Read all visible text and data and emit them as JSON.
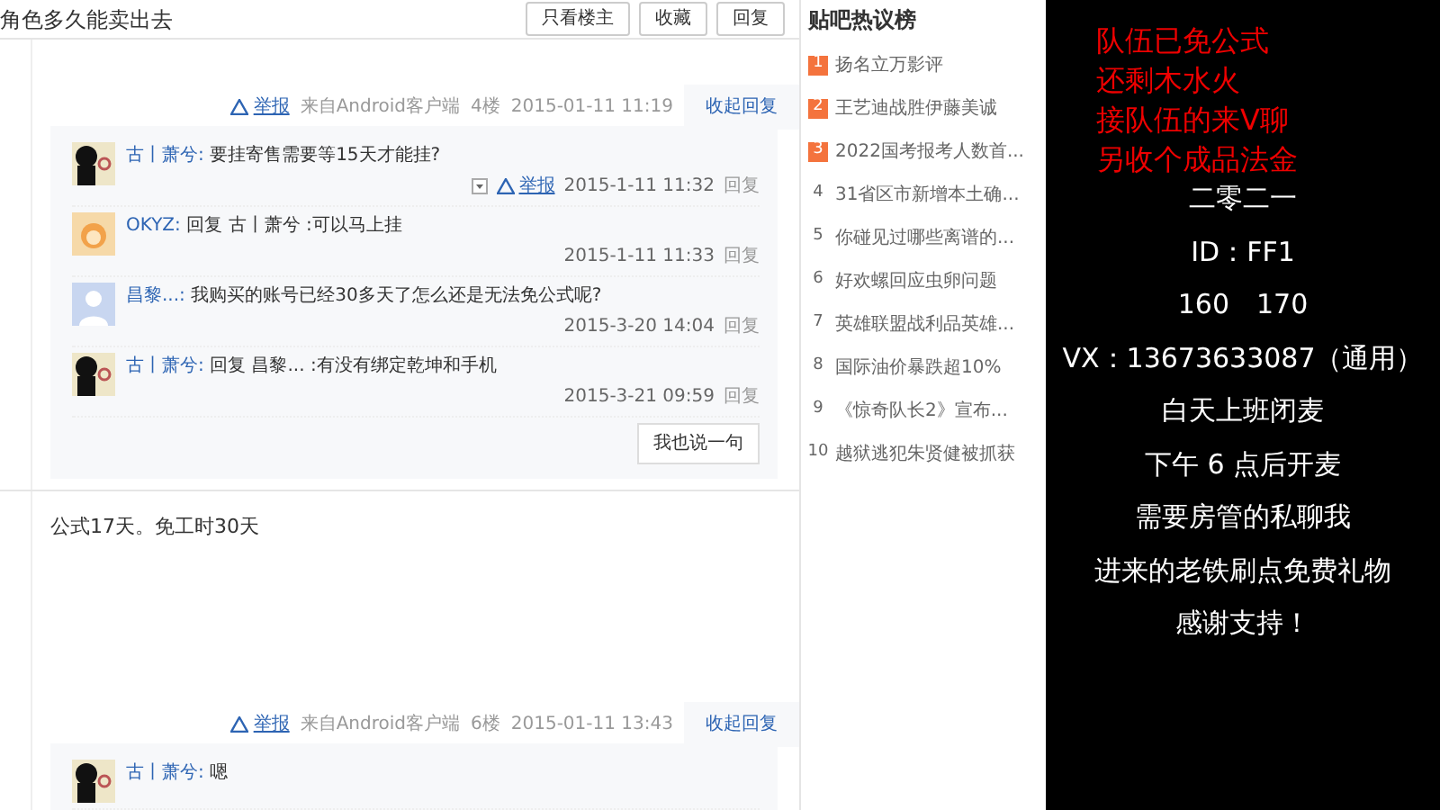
{
  "thread": {
    "title": "角色多久能卖出去",
    "buttons": [
      "只看楼主",
      "收藏",
      "回复"
    ]
  },
  "posts": [
    {
      "meta": {
        "report": "举报",
        "source": "来自Android客户端",
        "floor": "4楼",
        "time": "2015-01-11 11:19",
        "toggle": "收起回复"
      },
      "replies": [
        {
          "kind": "figure",
          "user": "古丨萧兮:",
          "text": "要挂寄售需要等15天才能挂?",
          "report": "举报",
          "time": "2015-1-11 11:32",
          "reply": "回复"
        },
        {
          "kind": "cartoon",
          "user": "OKYZ:",
          "text": "回复 古丨萧兮 :可以马上挂",
          "time": "2015-1-11 11:33",
          "reply": "回复"
        },
        {
          "kind": "default",
          "user": "昌黎...:",
          "text": "我购买的账号已经30多天了怎么还是无法免公式呢?",
          "time": "2015-3-20 14:04",
          "reply": "回复"
        },
        {
          "kind": "figure",
          "user": "古丨萧兮:",
          "text": "回复 昌黎... :有没有绑定乾坤和手机",
          "time": "2015-3-21 09:59",
          "reply": "回复"
        }
      ],
      "say_button": "我也说一句"
    },
    {
      "content": "公式17天。免工时30天",
      "meta": {
        "report": "举报",
        "source": "来自Android客户端",
        "floor": "6楼",
        "time": "2015-01-11 13:43",
        "toggle": "收起回复"
      },
      "replies": [
        {
          "kind": "figure",
          "user": "古丨萧兮:",
          "text": "嗯"
        }
      ]
    }
  ],
  "hot_list": {
    "title": "贴吧热议榜",
    "items": [
      {
        "rank": "1",
        "text": "扬名立万影评",
        "highlighted": true
      },
      {
        "rank": "2",
        "text": "王艺迪战胜伊藤美诚",
        "highlighted": true
      },
      {
        "rank": "3",
        "text": "2022国考报考人数首...",
        "highlighted": true
      },
      {
        "rank": "4",
        "text": "31省区市新增本土确...",
        "highlighted": false
      },
      {
        "rank": "5",
        "text": "你碰见过哪些离谱的...",
        "highlighted": false
      },
      {
        "rank": "6",
        "text": "好欢螺回应虫卵问题",
        "highlighted": false
      },
      {
        "rank": "7",
        "text": "英雄联盟战利品英雄...",
        "highlighted": false
      },
      {
        "rank": "8",
        "text": "国际油价暴跌超10%",
        "highlighted": false
      },
      {
        "rank": "9",
        "text": "《惊奇队长2》宣布...",
        "highlighted": false
      },
      {
        "rank": "10",
        "text": "越狱逃犯朱贤健被抓获",
        "highlighted": false
      }
    ]
  },
  "overlay": {
    "notice_lines": [
      "队伍已免公式",
      "还剩木水火",
      "接队伍的来V聊",
      "另收个成品法金"
    ],
    "info_lines": [
      "二零二一",
      "ID：FF1",
      "160　170",
      "VX：13673633087（通用）",
      "白天上班闭麦",
      "下午 6 点后开麦",
      "需要房管的私聊我",
      "进来的老铁刷点免费礼物",
      "感谢支持！"
    ]
  }
}
